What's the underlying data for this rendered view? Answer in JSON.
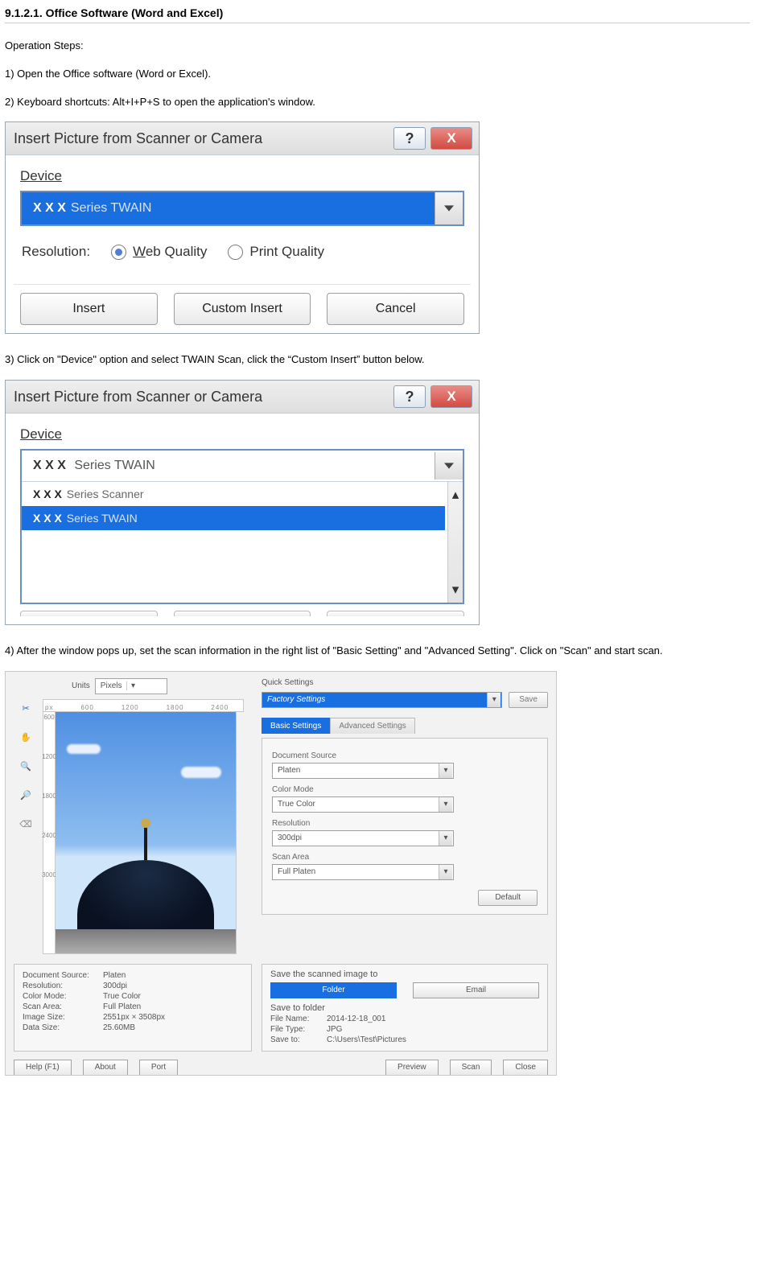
{
  "heading": "9.1.2.1. Office Software (Word and Excel)",
  "intro": "Operation Steps:",
  "step1": "1) Open the Office software (Word or Excel).",
  "step2": "2) Keyboard shortcuts: Alt+I+P+S to open the application's window.",
  "step3": "3) Click on \"Device\" option and select TWAIN Scan, click the “Custom Insert” button below.",
  "step4": "4) After the window pops up, set the scan information in the right list of \"Basic Setting\" and \"Advanced Setting\". Click on \"Scan\" and start scan.",
  "dialog": {
    "title": "Insert Picture from Scanner or Camera",
    "help": "?",
    "close": "X",
    "deviceLabel": "Device",
    "deviceValuePrefix": "X X X",
    "deviceValueSuffix": "Series TWAIN",
    "resolutionLabel": "Resolution:",
    "webQuality": "Web Quality",
    "printQuality": "Print Quality",
    "insert": "Insert",
    "customInsert": "Custom Insert",
    "cancel": "Cancel",
    "dropdown": {
      "item1Prefix": "X X X",
      "item1Suffix": "Series Scanner",
      "item2Prefix": "X X X",
      "item2Suffix": "Series TWAIN"
    }
  },
  "scan": {
    "unitsLabel": "Units",
    "units": "Pixels",
    "rulerH": {
      "a": "px",
      "b": "600",
      "c": "1200",
      "d": "1800",
      "e": "2400"
    },
    "rulerV": {
      "a": "600",
      "b": "1200",
      "c": "1800",
      "d": "2400",
      "e": "3000"
    },
    "quickSettingsLabel": "Quick Settings",
    "quickSettingsValue": "Factory Settings",
    "saveBtn": "Save",
    "tabBasic": "Basic Settings",
    "tabAdvanced": "Advanced Settings",
    "docSourceLabel": "Document Source",
    "docSource": "Platen",
    "colorModeLabel": "Color Mode",
    "colorMode": "True Color",
    "resolutionLabel": "Resolution",
    "resolution": "300dpi",
    "scanAreaLabel": "Scan Area",
    "scanArea": "Full Platen",
    "defaultBtn": "Default",
    "info": {
      "docSourceK": "Document Source:",
      "docSourceV": "Platen",
      "resK": "Resolution:",
      "resV": "300dpi",
      "cmK": "Color Mode:",
      "cmV": "True Color",
      "saK": "Scan Area:",
      "saV": "Full Platen",
      "isK": "Image Size:",
      "isV": "2551px × 3508px",
      "dsK": "Data Size:",
      "dsV": "25.60MB"
    },
    "saveBox": {
      "title": "Save the scanned image to",
      "folder": "Folder",
      "email": "Email",
      "saveTo": "Save to folder",
      "fnK": "File Name:",
      "fnV": "2014-12-18_001",
      "ftK": "File Type:",
      "ftV": "JPG",
      "stK": "Save to:",
      "stV": "C:\\Users\\Test\\Pictures"
    },
    "bottom": {
      "help": "Help (F1)",
      "about": "About",
      "port": "Port",
      "preview": "Preview",
      "scan": "Scan",
      "close": "Close"
    }
  }
}
